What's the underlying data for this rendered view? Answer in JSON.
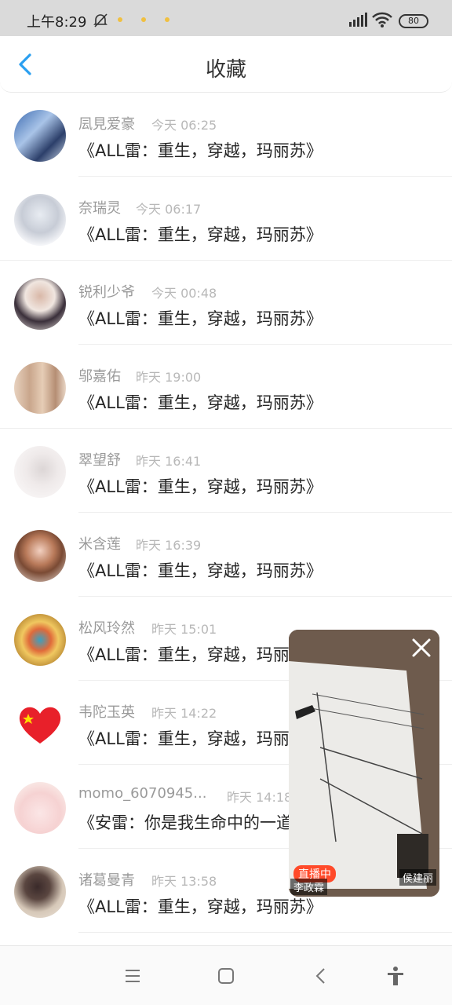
{
  "status_bar": {
    "time": "上午8:29",
    "battery": "80",
    "icons": [
      "mute-icon",
      "signal-icon",
      "wifi-icon",
      "battery-icon"
    ]
  },
  "header": {
    "title": "收藏",
    "back_icon": "chevron-left-icon"
  },
  "favorites": [
    {
      "user": "凨見爱豪",
      "time": "今天 06:25",
      "title": "《ALL雷：重生，穿越，玛丽苏》"
    },
    {
      "user": "奈瑞灵",
      "time": "今天 06:17",
      "title": "《ALL雷：重生，穿越，玛丽苏》"
    },
    {
      "user": "锐利少爷",
      "time": "今天 00:48",
      "title": "《ALL雷：重生，穿越，玛丽苏》"
    },
    {
      "user": "邬嘉佑",
      "time": "昨天 19:00",
      "title": "《ALL雷：重生，穿越，玛丽苏》"
    },
    {
      "user": "翠望舒",
      "time": "昨天 16:41",
      "title": "《ALL雷：重生，穿越，玛丽苏》"
    },
    {
      "user": "米含莲",
      "time": "昨天 16:39",
      "title": "《ALL雷：重生，穿越，玛丽苏》"
    },
    {
      "user": "松风玲然",
      "time": "昨天 15:01",
      "title": "《ALL雷：重生，穿越，玛丽苏》"
    },
    {
      "user": "韦陀玉英",
      "time": "昨天 14:22",
      "title": "《ALL雷：重生，穿越，玛丽苏》"
    },
    {
      "user": "momo_6070945...",
      "time": "昨天 14:18",
      "title": "《安雷：你是我生命中的一道"
    },
    {
      "user": "诸葛曼青",
      "time": "昨天 13:58",
      "title": "《ALL雷：重生，穿越，玛丽苏》"
    }
  ],
  "live_window": {
    "badge": "直播中",
    "host": "李政霖",
    "guest": "侯建丽",
    "close_icon": "close-icon"
  },
  "nav_bar": {
    "icons": [
      "menu-icon",
      "home-square-icon",
      "back-chevron-icon",
      "accessibility-icon"
    ]
  },
  "colors": {
    "accent": "#2a9ff0",
    "username": "#9a9a9a",
    "time": "#b8b8b8",
    "live_badge": "#ff4a2a"
  }
}
